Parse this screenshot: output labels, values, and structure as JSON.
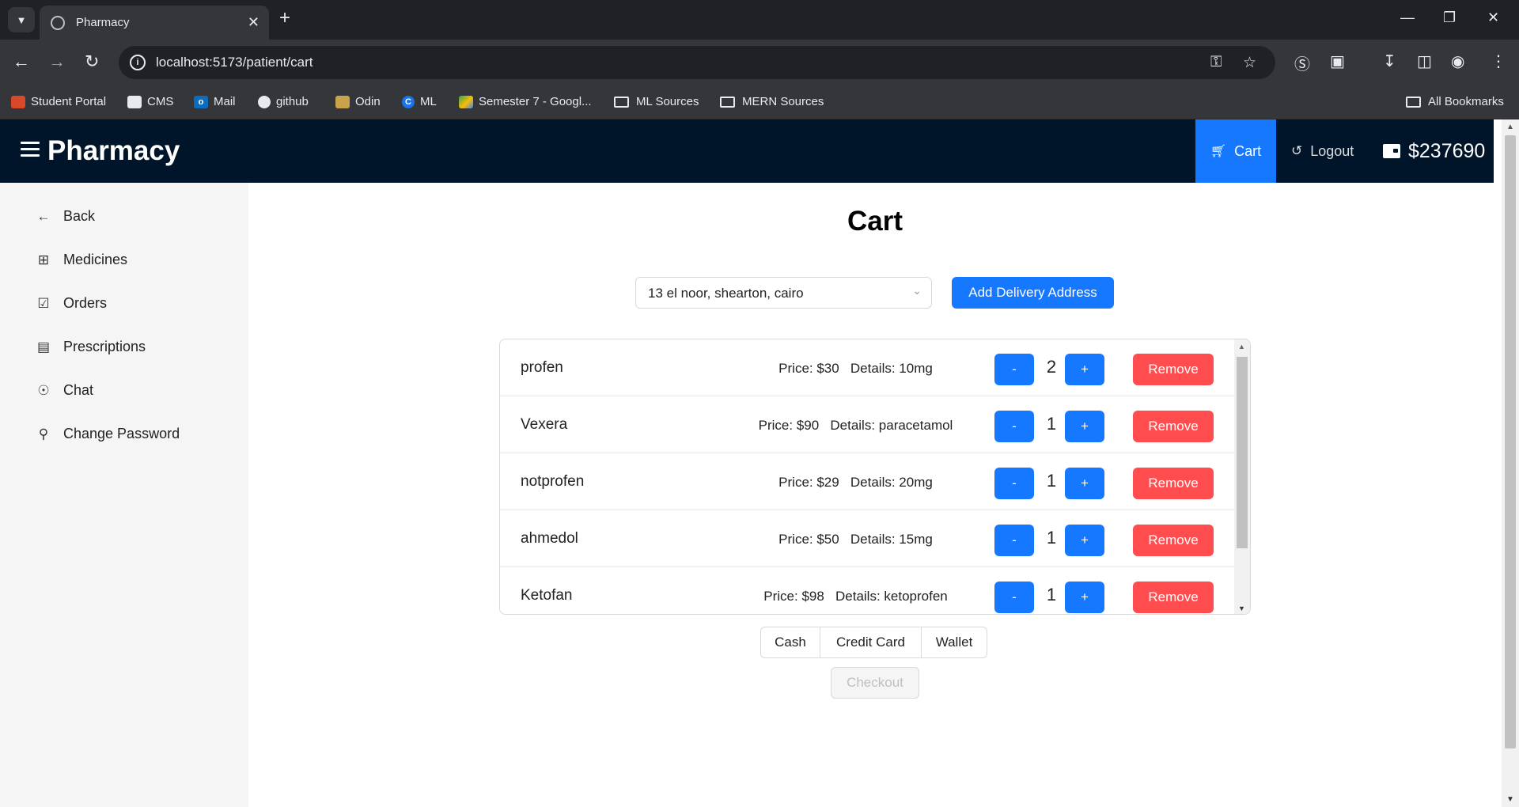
{
  "browser": {
    "tab_title": "Pharmacy",
    "url": "localhost:5173/patient/cart",
    "bookmarks": [
      {
        "label": "Student Portal",
        "icon": "student-portal-icon"
      },
      {
        "label": "CMS",
        "icon": "cms-icon"
      },
      {
        "label": "Mail",
        "icon": "outlook-icon"
      },
      {
        "label": "github",
        "icon": "github-icon"
      },
      {
        "label": "Odin",
        "icon": "odin-icon"
      },
      {
        "label": "ML",
        "icon": "ml-icon"
      },
      {
        "label": "Semester 7 - Googl...",
        "icon": "google-drive-icon"
      },
      {
        "label": "ML Sources",
        "icon": "folder-icon"
      },
      {
        "label": "MERN Sources",
        "icon": "folder-icon"
      }
    ],
    "all_bookmarks": "All Bookmarks"
  },
  "header": {
    "brand": "Pharmacy",
    "cart_label": "Cart",
    "logout_label": "Logout",
    "wallet_amount": "$237690"
  },
  "sidebar": {
    "items": [
      {
        "label": "Back",
        "icon": "arrow-left-icon"
      },
      {
        "label": "Medicines",
        "icon": "medicine-box-icon"
      },
      {
        "label": "Orders",
        "icon": "shopping-bag-icon"
      },
      {
        "label": "Prescriptions",
        "icon": "prescription-icon"
      },
      {
        "label": "Chat",
        "icon": "chat-icon"
      },
      {
        "label": "Change Password",
        "icon": "key-icon"
      }
    ]
  },
  "main": {
    "title": "Cart",
    "address_selected": "13 el noor, shearton, cairo",
    "add_address_label": "Add Delivery Address",
    "cart_items": [
      {
        "name": "profen",
        "price": "Price: $30",
        "details": "Details: 10mg",
        "qty": "2"
      },
      {
        "name": "Vexera",
        "price": "Price: $90",
        "details": "Details: paracetamol",
        "qty": "1"
      },
      {
        "name": "notprofen",
        "price": "Price: $29",
        "details": "Details: 20mg",
        "qty": "1"
      },
      {
        "name": "ahmedol",
        "price": "Price: $50",
        "details": "Details: 15mg",
        "qty": "1"
      },
      {
        "name": "Ketofan",
        "price": "Price: $98",
        "details": "Details: ketoprofen",
        "qty": "1"
      }
    ],
    "minus_label": "-",
    "plus_label": "+",
    "remove_label": "Remove",
    "payment_methods": [
      "Cash",
      "Credit Card",
      "Wallet"
    ],
    "checkout_label": "Checkout"
  },
  "colors": {
    "header_bg": "#001529",
    "primary": "#1677ff",
    "danger": "#ff4d4f",
    "sidebar_bg": "#f5f5f5"
  }
}
